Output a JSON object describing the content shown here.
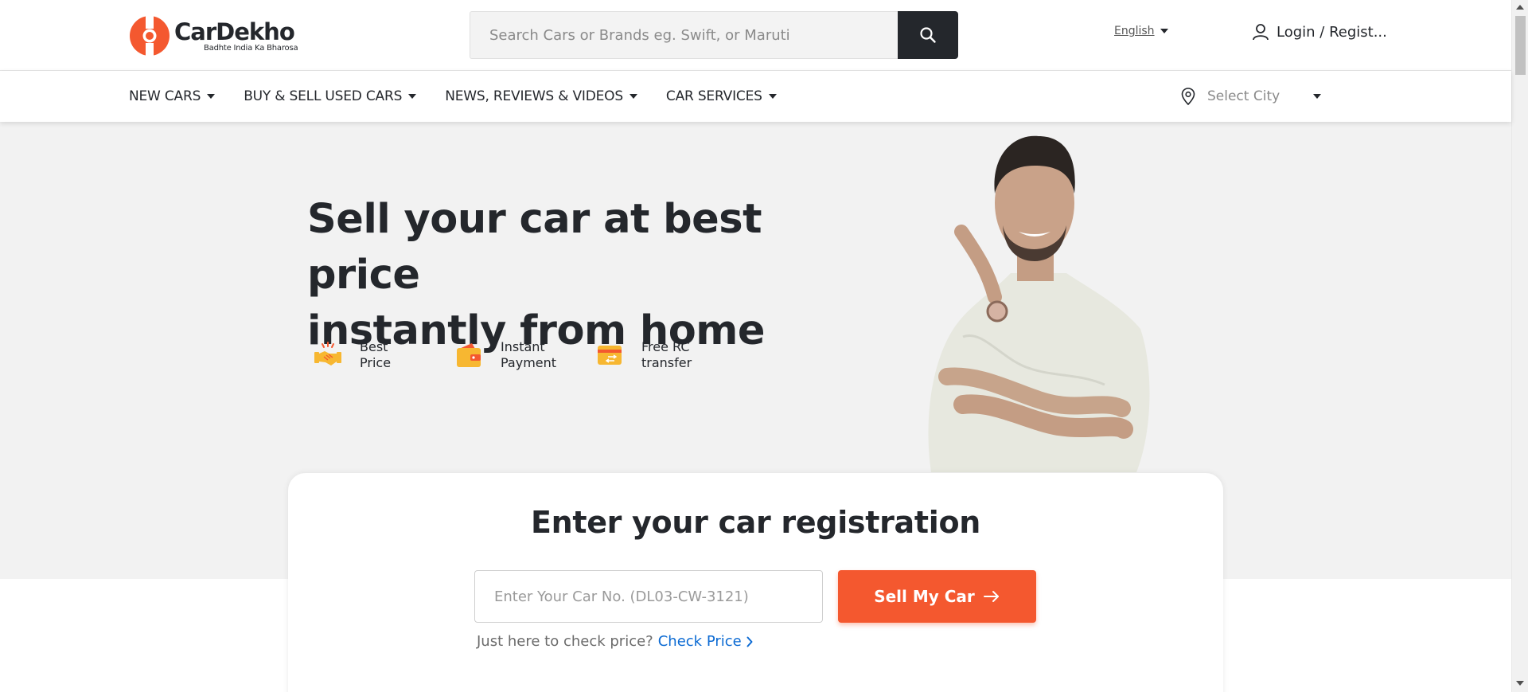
{
  "header": {
    "logo": {
      "name": "CarDekho",
      "tagline": "Badhte India Ka Bharosa",
      "brand_color": "#f4582f"
    },
    "search": {
      "placeholder": "Search Cars or Brands eg. Swift, or Maruti",
      "value": "",
      "icon": "search-icon"
    },
    "language": {
      "label": "English"
    },
    "login": {
      "label": "Login / Regist...",
      "icon": "user-icon"
    }
  },
  "nav": {
    "items": [
      {
        "label": "NEW CARS"
      },
      {
        "label": "BUY & SELL USED CARS"
      },
      {
        "label": "NEWS, REVIEWS & VIDEOS"
      },
      {
        "label": "CAR SERVICES"
      }
    ],
    "city": {
      "label": "Select City",
      "icon": "location-pin-icon"
    }
  },
  "hero": {
    "headline_line1": "Sell your car at best price",
    "headline_line2": "instantly from home",
    "features": [
      {
        "line1": "Best",
        "line2": "Price",
        "icon": "handshake-icon"
      },
      {
        "line1": "Instant",
        "line2": "Payment",
        "icon": "wallet-icon"
      },
      {
        "line1": "Free RC",
        "line2": "transfer",
        "icon": "rc-card-icon"
      }
    ],
    "accent_color": "#f7b731"
  },
  "card": {
    "title": "Enter your car registration",
    "input": {
      "placeholder": "Enter Your Car No. (DL03-CW-3121)",
      "value": ""
    },
    "button": {
      "label": "Sell My Car",
      "color": "#f4582f"
    },
    "check_text": "Just here to check price?",
    "check_link": "Check Price",
    "link_color": "#0b6ad3"
  }
}
